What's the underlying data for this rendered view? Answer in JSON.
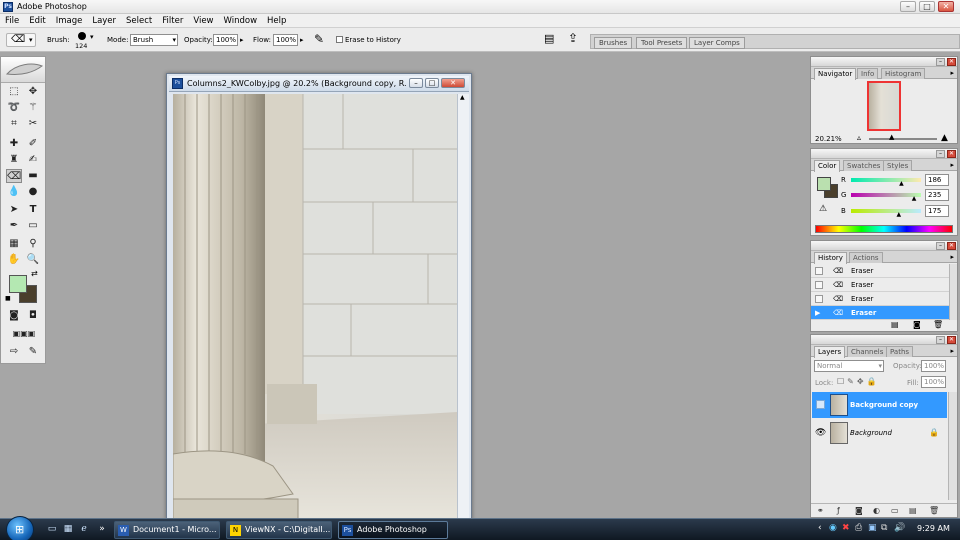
{
  "app": {
    "title": "Adobe Photoshop",
    "logo_text": "Ps"
  },
  "menu": [
    "File",
    "Edit",
    "Image",
    "Layer",
    "Select",
    "Filter",
    "View",
    "Window",
    "Help"
  ],
  "options": {
    "brush_label": "Brush:",
    "brush_size": "124",
    "mode_label": "Mode:",
    "mode_value": "Brush",
    "opacity_label": "Opacity:",
    "opacity_value": "100%",
    "flow_label": "Flow:",
    "flow_value": "100%",
    "erase_history_label": "Erase to History",
    "erase_history_checked": false
  },
  "palette_well": {
    "tabs": [
      "Brushes",
      "Tool Presets",
      "Layer Comps"
    ]
  },
  "toolbox": {
    "tools": [
      "marquee-icon",
      "move-icon",
      "lasso-icon",
      "magic-wand-icon",
      "crop-icon",
      "slice-icon",
      "healing-brush-icon",
      "brush-icon",
      "clone-stamp-icon",
      "history-brush-icon",
      "eraser-icon",
      "gradient-icon",
      "blur-icon",
      "dodge-icon",
      "path-selection-icon",
      "type-icon",
      "pen-icon",
      "shape-icon",
      "notes-icon",
      "eyedropper-icon",
      "hand-icon",
      "zoom-icon"
    ],
    "foreground_color": "#b4e8b2",
    "background_color": "#4a3f2c"
  },
  "document": {
    "title": "Columns2_KWColby.jpg @ 20.2% (Background copy, R..."
  },
  "navigator": {
    "tabs": [
      "Navigator",
      "Info",
      "Histogram"
    ],
    "active_tab": "Navigator",
    "zoom": "20.21%"
  },
  "color_panel": {
    "tabs": [
      "Color",
      "Swatches",
      "Styles"
    ],
    "active_tab": "Color",
    "channels": [
      {
        "label": "R",
        "value": "186",
        "level": 0.73
      },
      {
        "label": "G",
        "value": "235",
        "level": 0.92
      },
      {
        "label": "B",
        "value": "175",
        "level": 0.69
      }
    ],
    "foreground_color": "#bae0af"
  },
  "history_panel": {
    "tabs": [
      "History",
      "Actions"
    ],
    "active_tab": "History",
    "items": [
      "Eraser",
      "Eraser",
      "Eraser",
      "Eraser"
    ],
    "selected_index": 3
  },
  "layers_panel": {
    "tabs": [
      "Layers",
      "Channels",
      "Paths"
    ],
    "active_tab": "Layers",
    "blend_mode": "Normal",
    "opacity_label": "Opacity:",
    "opacity_value": "100%",
    "lock_label": "Lock:",
    "fill_label": "Fill:",
    "fill_value": "100%",
    "layers": [
      {
        "name": "Background copy",
        "selected": true,
        "visible": false
      },
      {
        "name": "Background",
        "selected": false,
        "visible": true,
        "locked": true
      }
    ]
  },
  "taskbar": {
    "items": [
      {
        "label": "Document1 - Micro...",
        "icon": "word-icon",
        "active": false
      },
      {
        "label": "ViewNX - C:\\DigitalI...",
        "icon": "viewnx-icon",
        "active": false
      },
      {
        "label": "Adobe Photoshop",
        "icon": "photoshop-icon",
        "active": true
      }
    ],
    "clock": "9:29 AM",
    "overflow": "»"
  },
  "colors": {
    "selection_blue": "#3399ff",
    "panel_bg": "#ececec",
    "workspace": "#a6a6a6"
  }
}
